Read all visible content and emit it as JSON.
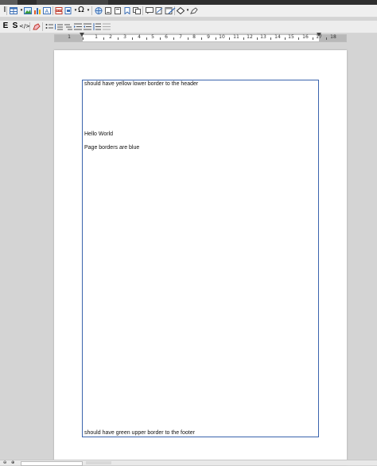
{
  "toolbar1": {
    "icons": [
      "text-cursor-icon",
      "table-icon",
      "image-icon",
      "chart-icon",
      "textbox-icon",
      "page-break-icon",
      "field-icon",
      "special-char-icon",
      "hyperlink-icon",
      "footnote-icon",
      "endnote-icon",
      "bookmark-icon",
      "cross-ref-icon",
      "comment-icon",
      "track-changes-icon",
      "header-footer-icon",
      "line-icon",
      "shapes-icon",
      "draw-icon"
    ]
  },
  "toolbar2": {
    "style_e": "E",
    "style_s": "S",
    "code": "</>"
  },
  "ruler": {
    "numbers": [
      "1",
      "1",
      "2",
      "3",
      "4",
      "5",
      "6",
      "7",
      "8",
      "9",
      "10",
      "11",
      "12",
      "13",
      "14",
      "15",
      "16",
      "17",
      "18"
    ]
  },
  "document": {
    "header_text": "should have yellow lower border to the header",
    "hello": "Hello World",
    "page_borders": "Page borders are blue",
    "footer_text": "should have green upper border to the footer"
  },
  "colors": {
    "page_border": "#3a64ad"
  }
}
